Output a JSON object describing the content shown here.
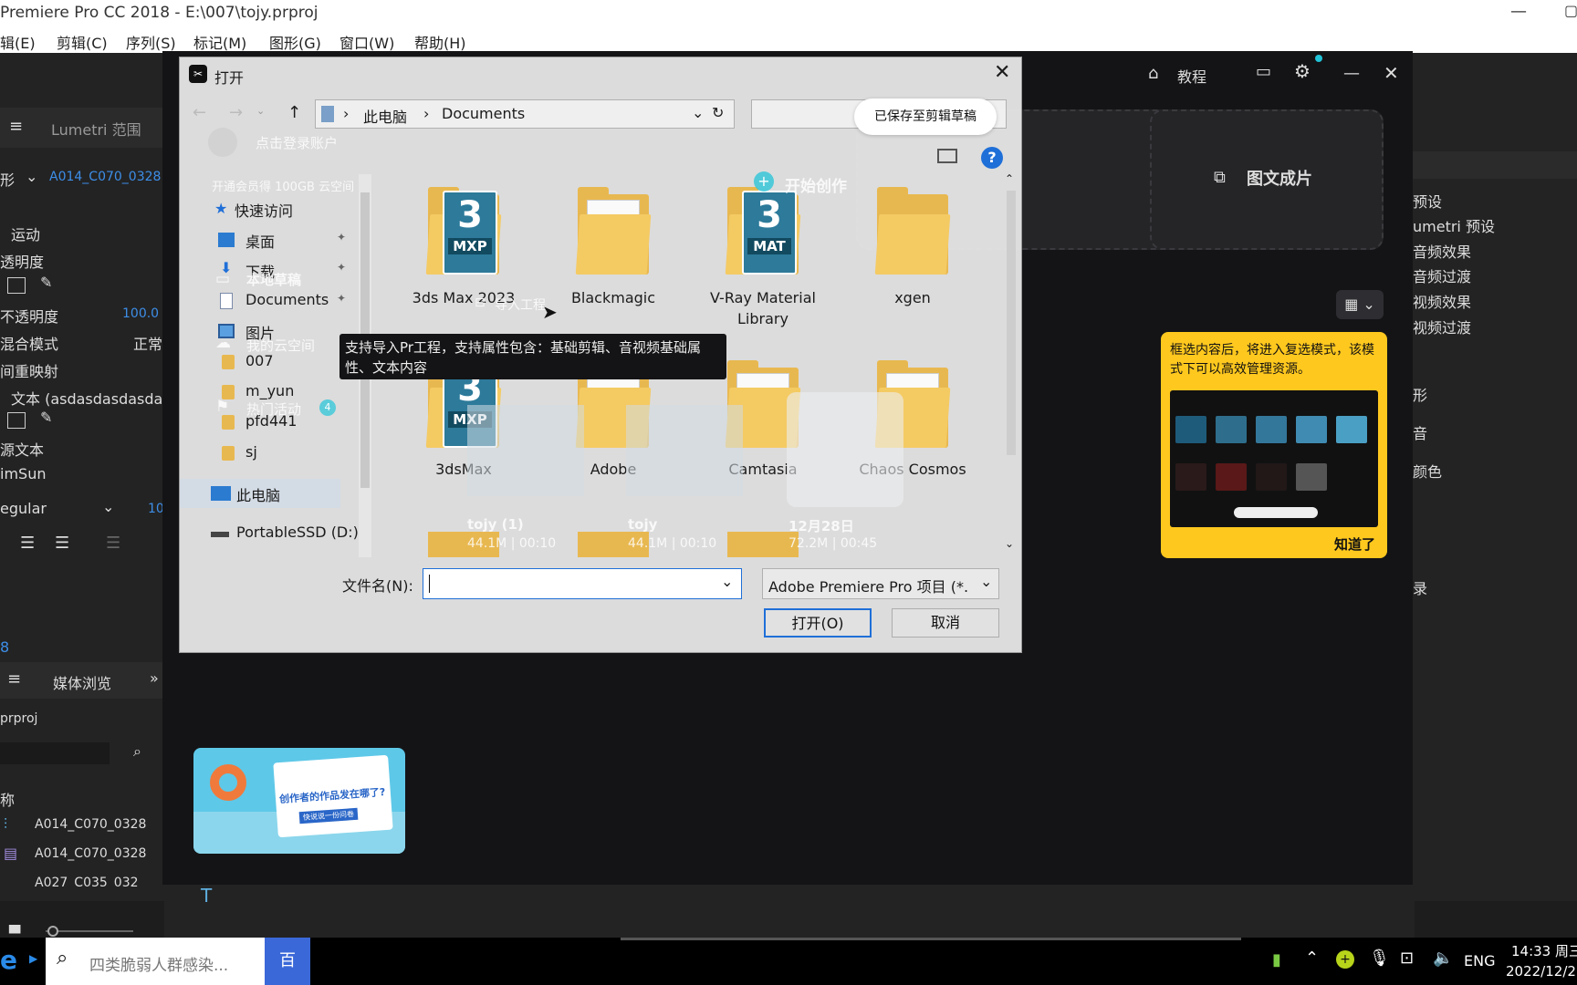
{
  "pr": {
    "title": "Premiere Pro CC 2018 - E:\\007\\tojy.prproj",
    "menu": [
      "辑(E)",
      "剪辑(C)",
      "序列(S)",
      "标记(M)",
      "图形(G)",
      "窗口(W)",
      "帮助(H)"
    ],
    "left_panel": {
      "tab": "Lumetri 范围",
      "clip_prefix": "形",
      "clip_name": "A014_C070_0328",
      "motion": "运动",
      "opacity": "透明度",
      "opacity_prop": "不透明度",
      "opacity_value": "100.0",
      "blend_mode": "混合模式",
      "blend_value": "正常",
      "time_remap": "间重映射",
      "text_layer": "文本 (asdasdasdasdasd",
      "source_text": "源文本",
      "font": "imSun",
      "style": "egular",
      "size": "10",
      "num": "8",
      "media_tab": "媒体浏览",
      "project": "prproj",
      "col_name": "称",
      "items": [
        "A014_C070_0328",
        "A014_C070_0328",
        "A027_C035_032"
      ]
    },
    "right_panel": {
      "items": [
        "预设",
        "umetri 预设",
        "音频效果",
        "音频过渡",
        "视频效果",
        "视频过渡",
        "形",
        "音",
        "颜色",
        "录"
      ]
    }
  },
  "jianying": {
    "topbar": {
      "tutorial": "教程"
    },
    "login": "点击登录账户",
    "vip": "开通会员得 100GB 云空间",
    "start": "开始创作",
    "nav": [
      "本地草稿",
      "我的云空间",
      "热门活动"
    ],
    "hot_badge": "4",
    "import_label": "导入工程",
    "saved_pill": "已保存至剪辑草稿",
    "image_to_video": "图文成片",
    "drafts": [
      {
        "name": "tojy (1)",
        "meta": "44.1M | 00:10"
      },
      {
        "name": "tojy",
        "meta": "44.1M | 00:10"
      },
      {
        "name": "12月28日",
        "meta": "72.2M | 00:45"
      }
    ],
    "tip": {
      "text": "框选内容后，将进入复选模式，该模式下可以高效管理资源。",
      "ok": "知道了"
    },
    "banner": {
      "line1": "创作者的作品发在哪了?",
      "line2": "快说说一份问卷"
    },
    "tooltip": "支持导入Pr工程，支持属性包含：基础剪辑、音视频基础属性、文本内容"
  },
  "dialog": {
    "title": "打开",
    "path": [
      "此电脑",
      "Documents"
    ],
    "sidebar": [
      {
        "label": "快速访问",
        "icon": "star-icon"
      },
      {
        "label": "桌面",
        "icon": "desktop-icon",
        "pin": true
      },
      {
        "label": "下载",
        "icon": "download-icon",
        "pin": true
      },
      {
        "label": "Documents",
        "icon": "documents-icon",
        "pin": true
      },
      {
        "label": "图片",
        "icon": "pictures-icon",
        "pin": true
      },
      {
        "label": "007",
        "icon": "folder-icon"
      },
      {
        "label": "m_yun",
        "icon": "folder-icon"
      },
      {
        "label": "pfd441",
        "icon": "folder-icon"
      },
      {
        "label": "sj",
        "icon": "folder-icon"
      },
      {
        "label": "此电脑",
        "icon": "computer-icon"
      },
      {
        "label": "PortableSSD (D:)",
        "icon": "drive-icon"
      }
    ],
    "files": [
      {
        "name": "3ds Max 2023",
        "kind": "mxp"
      },
      {
        "name": "Blackmagic",
        "kind": "folder"
      },
      {
        "name": "V-Ray Material Library",
        "kind": "mat"
      },
      {
        "name": "xgen",
        "kind": "folder"
      },
      {
        "name": "3dsMax",
        "kind": "mxp"
      },
      {
        "name": "Adobe",
        "kind": "folder"
      },
      {
        "name": "Camtasia",
        "kind": "folder"
      },
      {
        "name": "Chaos Cosmos",
        "kind": "folder"
      }
    ],
    "filename_label": "文件名(N):",
    "filename_value": "",
    "filetype": "Adobe Premiere Pro 项目 (*.",
    "open_btn": "打开(O)",
    "cancel_btn": "取消"
  },
  "taskbar": {
    "search_placeholder": "四类脆弱人群感染...",
    "baidu": "百度",
    "lang": "ENG",
    "time": "14:33 周三",
    "date": "2022/12/2"
  }
}
